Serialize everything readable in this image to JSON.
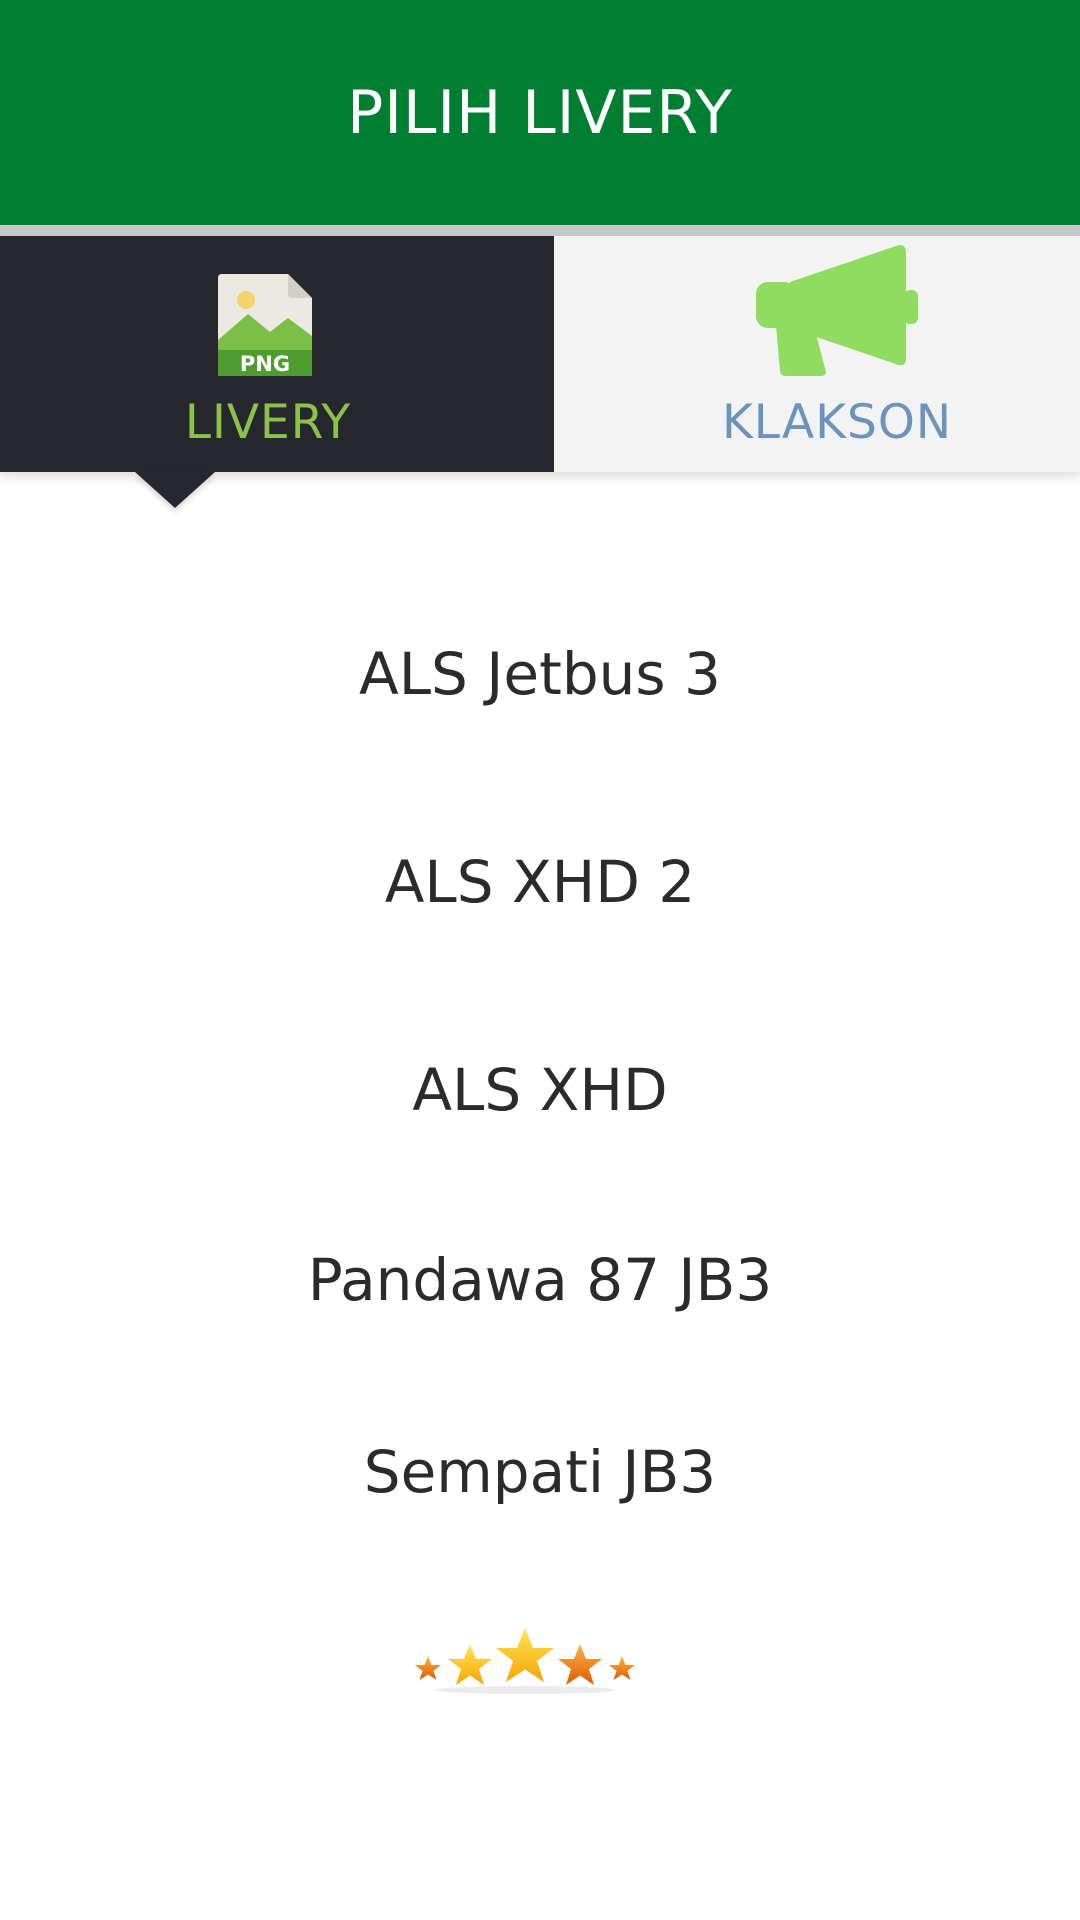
{
  "app_bar": {
    "title": "PILIH LIVERY",
    "color": "#007f33"
  },
  "tabs": [
    {
      "label": "LIVERY",
      "icon": "png-image-file-icon",
      "selected": true
    },
    {
      "label": "KLAKSON",
      "icon": "megaphone-icon",
      "selected": false
    }
  ],
  "livery_icon_text": "PNG",
  "list": {
    "items": [
      {
        "label": "ALS Jetbus 3"
      },
      {
        "label": "ALS XHD 2"
      },
      {
        "label": "ALS XHD"
      },
      {
        "label": "Pandawa 87 JB3"
      },
      {
        "label": "Sempati JB3"
      }
    ]
  },
  "rating_icon": "five-stars-icon",
  "colors": {
    "accent_green": "#8bc34a",
    "tab_dark": "#27282d",
    "klakson_label": "#6b93bd"
  }
}
